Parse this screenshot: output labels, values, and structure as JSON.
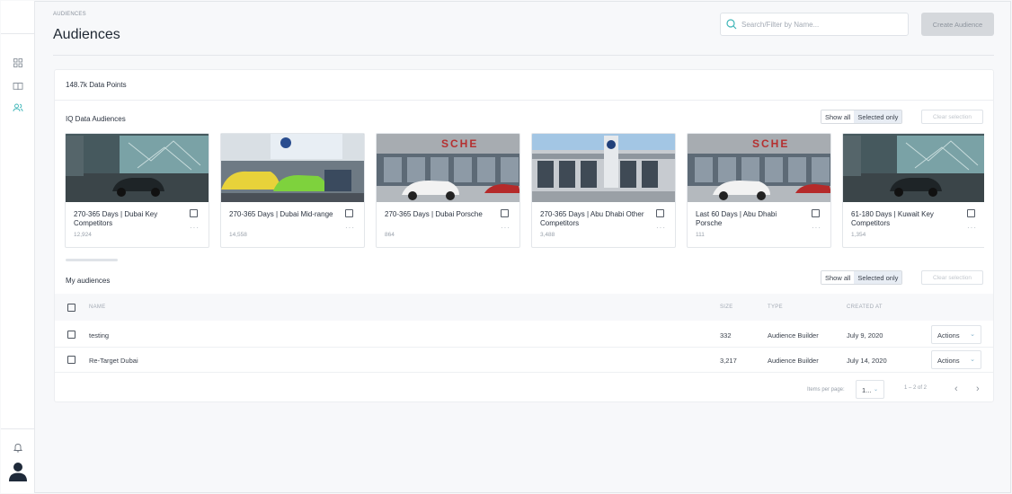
{
  "header": {
    "breadcrumb": "AUDIENCES",
    "title": "Audiences",
    "search_placeholder": "Search/Filter by Name...",
    "create_button": "Create Audience"
  },
  "sidebar": {
    "items": [
      {
        "icon": "grid-icon"
      },
      {
        "icon": "book-icon"
      },
      {
        "icon": "users-icon",
        "active": true
      }
    ],
    "bottom": [
      {
        "icon": "bell-icon"
      },
      {
        "icon": "avatar"
      }
    ]
  },
  "summary": {
    "data_points": "148.7k Data Points"
  },
  "iq_section": {
    "title": "IQ Data Audiences",
    "show_all": "Show all",
    "selected_only": "Selected only",
    "clear_selection": "Clear selection",
    "tiles": [
      {
        "name": "270-365 Days | Dubai Key Competitors",
        "count": "12,924",
        "image": "showroom-dark"
      },
      {
        "name": "270-365 Days | Dubai Mid-range",
        "count": "14,558",
        "image": "auto-show"
      },
      {
        "name": "270-365 Days | Dubai Porsche",
        "count": "864",
        "image": "porsche"
      },
      {
        "name": "270-365 Days | Abu Dhabi Other Competitors",
        "count": "3,488",
        "image": "dealership"
      },
      {
        "name": "Last 60 Days | Abu Dhabi Porsche",
        "count": "111",
        "image": "porsche"
      },
      {
        "name": "61-180 Days | Kuwait Key Competitors",
        "count": "1,354",
        "image": "showroom-dark"
      }
    ]
  },
  "my_section": {
    "title": "My audiences",
    "show_all": "Show all",
    "selected_only": "Selected only",
    "clear_selection": "Clear selection",
    "columns": {
      "name": "NAME",
      "size": "SIZE",
      "type": "TYPE",
      "created": "CREATED AT"
    },
    "rows": [
      {
        "name": "testing",
        "size": "332",
        "type": "Audience Builder",
        "created": "July 9, 2020",
        "actions": "Actions"
      },
      {
        "name": "Re-Target Dubai",
        "size": "3,217",
        "type": "Audience Builder",
        "created": "July 14, 2020",
        "actions": "Actions"
      }
    ],
    "pagination": {
      "items_label": "Items per page:",
      "per_page": "1...",
      "range": "1 – 2 of 2"
    }
  },
  "colors": {
    "accent": "#3fb6b8",
    "button_disabled": "#d5d8dc"
  }
}
